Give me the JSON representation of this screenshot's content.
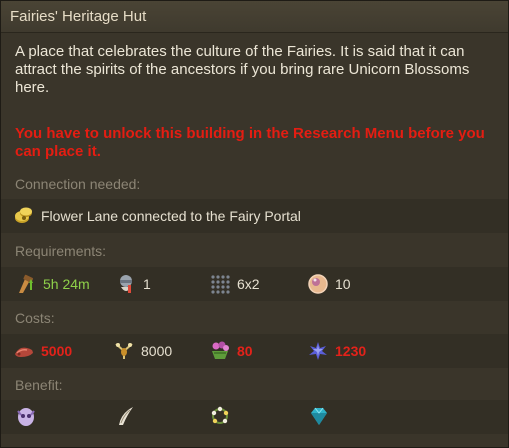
{
  "title": "Fairies' Heritage Hut",
  "description": "A place that celebrates the culture of the Fairies. It is said that it can attract the spirits of the ancestors if you bring rare Unicorn Blossoms here.",
  "warning": "You have to unlock this building in the Research Menu before you can place it.",
  "connection": {
    "label": "Connection needed:",
    "text": "Flower Lane connected to the Fairy Portal",
    "icon": "road-coin-icon"
  },
  "requirements": {
    "label": "Requirements:",
    "items": [
      {
        "icon": "build-time-icon",
        "value": "5h 24m",
        "color": "#8fd14a"
      },
      {
        "icon": "worker-icon",
        "value": "1"
      },
      {
        "icon": "size-grid-icon",
        "value": "6x2"
      },
      {
        "icon": "population-orb-icon",
        "value": "10"
      }
    ]
  },
  "costs": {
    "label": "Costs:",
    "items": [
      {
        "icon": "supplies-icon",
        "value": "5000",
        "color": "#e3221a"
      },
      {
        "icon": "coins-icon",
        "value": "8000"
      },
      {
        "icon": "flower-basket-icon",
        "value": "80",
        "color": "#e3221a"
      },
      {
        "icon": "crystal-icon",
        "value": "1230",
        "color": "#e3221a"
      }
    ]
  },
  "benefit": {
    "label": "Benefit:",
    "icons": [
      "ancestor-spirit-icon",
      "horn-icon",
      "flower-wreath-icon",
      "gem-icon"
    ]
  }
}
